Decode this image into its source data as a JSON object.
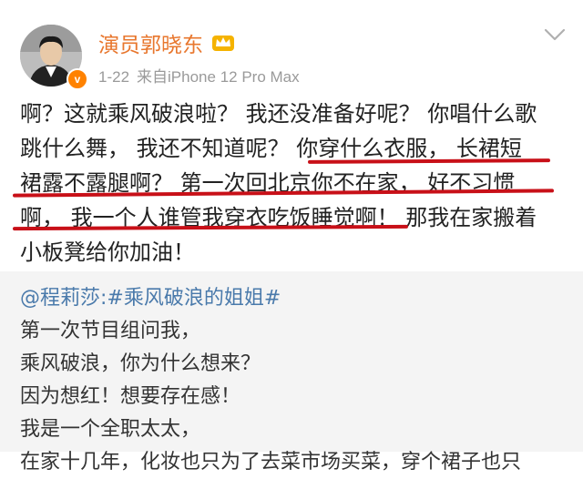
{
  "header": {
    "username": "演员郭晓东",
    "vip_badge": "v",
    "date": "1-22",
    "source": "来自iPhone 12 Pro Max",
    "icons": [
      "avatar",
      "vip-badge",
      "crown-icon",
      "chevron-down-icon"
    ],
    "username_color": "#e8772e"
  },
  "post": {
    "lines": [
      "啊？这就乘风破浪啦？ 我还没准备好呢？ 你唱什么歌",
      "跳什么舞， 我还不知道呢？ 你穿什么衣服， 长裙短",
      "裙露不露腿啊？ 第一次回北京你不在家， 好不习惯",
      "啊， 我一个人谁管我穿衣吃饭睡觉啊！ 那我在家搬着",
      "小板凳给你加油！"
    ],
    "underline_color": "#c81018"
  },
  "repost": {
    "mention": "@程莉莎:",
    "topic": "#乘风破浪的姐姐#",
    "lines": [
      "第一次节目组问我，",
      "乘风破浪，你为什么想来？",
      "因为想红！想要存在感！",
      "我是一个全职太太，",
      "在家十几年，化妆也只为了去菜市场买菜，穿个裙子也只"
    ],
    "link_color": "#4a7aab",
    "background": "#f4f4f4"
  }
}
